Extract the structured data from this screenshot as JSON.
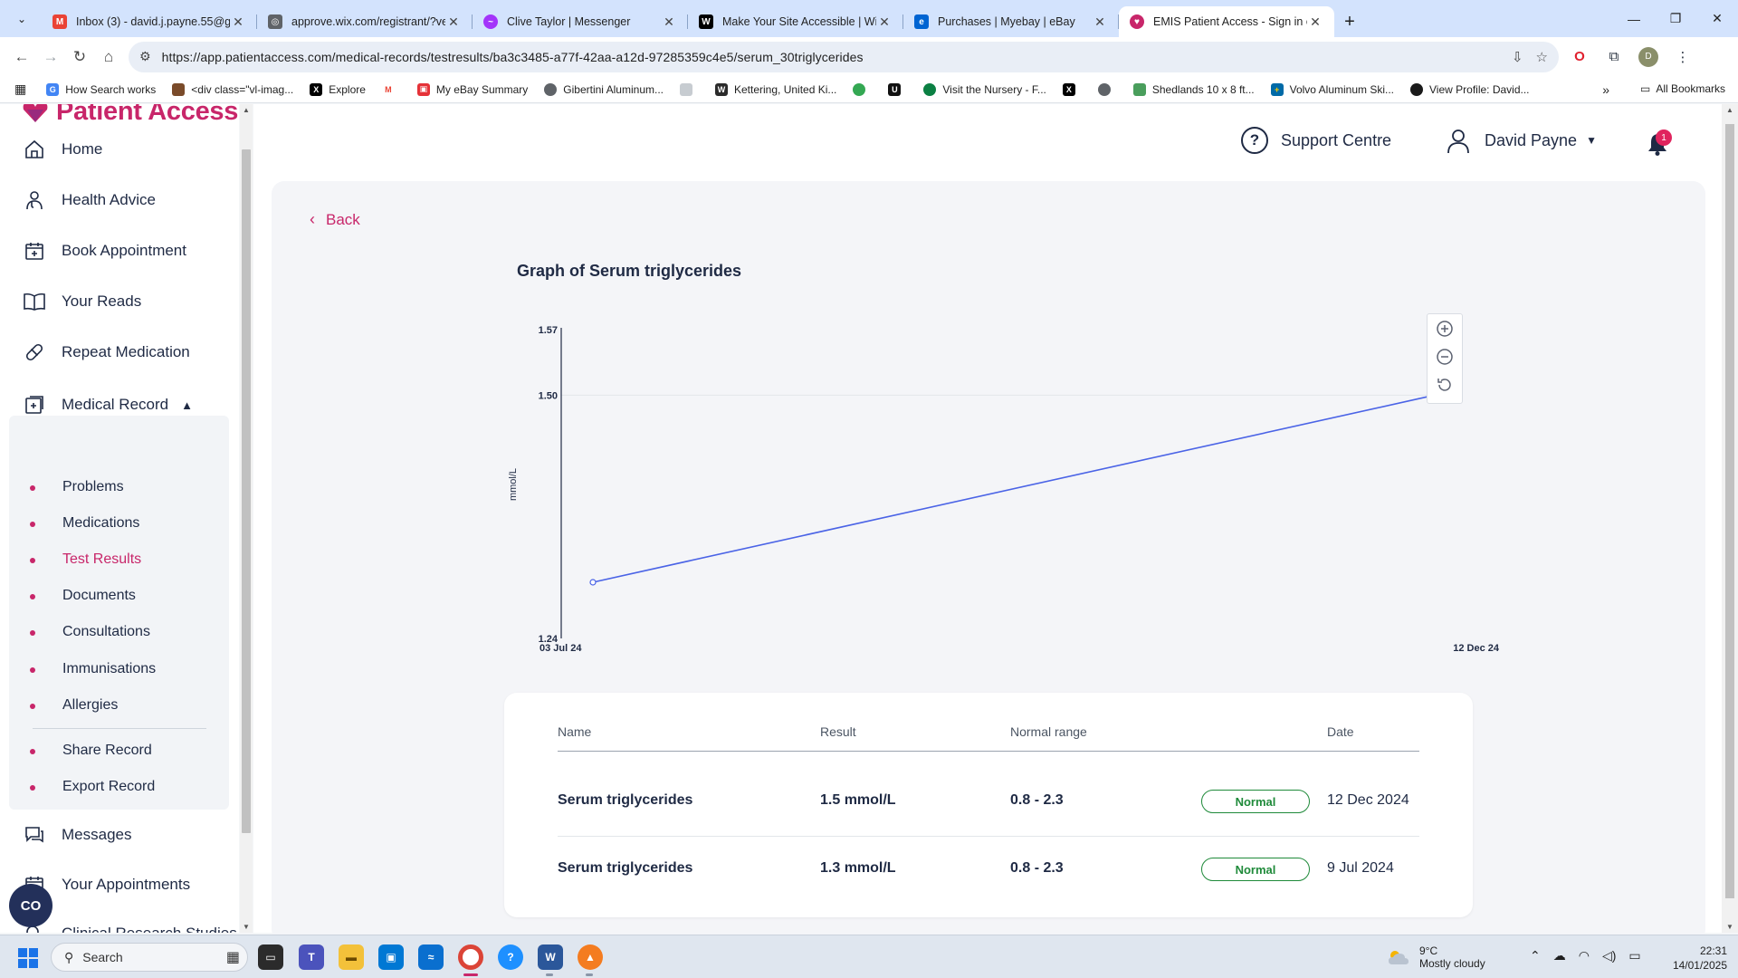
{
  "browser": {
    "tabs": [
      {
        "title": "Inbox (3) - david.j.payne.55@gr",
        "favicon": "gmail-icon",
        "color": "#ea4335"
      },
      {
        "title": "approve.wix.com/registrant/?ve",
        "favicon": "globe-icon",
        "color": "#5f6368"
      },
      {
        "title": "Clive Taylor | Messenger",
        "favicon": "messenger-icon",
        "color": "#a334fa"
      },
      {
        "title": "Make Your Site Accessible | Wix",
        "favicon": "wix-icon",
        "color": "#000000"
      },
      {
        "title": "Purchases | Myebay | eBay",
        "favicon": "ebay-icon",
        "color": "#0064d2"
      },
      {
        "title": "EMIS Patient Access - Sign in o",
        "favicon": "patient-access-icon",
        "color": "#c8266a"
      }
    ],
    "url": "https://app.patientaccess.com/medical-records/testresults/ba3c3485-a77f-42aa-a12d-97285359c4e5/serum_30triglycerides",
    "bookmarks": [
      {
        "label": "How Search works",
        "icon": "google-icon",
        "color": "#4285f4"
      },
      {
        "label": "<div class=\"vl-imag...",
        "icon": "bookmark-icon",
        "color": "#7a4b2a"
      },
      {
        "label": "Explore",
        "icon": "x-icon",
        "color": "#000000"
      },
      {
        "label": "",
        "icon": "gmail-icon",
        "color": "#ea4335"
      },
      {
        "label": "My eBay Summary",
        "icon": "ebay-icon",
        "color": "#e53238"
      },
      {
        "label": "Gibertini Aluminum...",
        "icon": "globe-icon",
        "color": "#5f6368"
      },
      {
        "label": "",
        "icon": "bookmark-icon",
        "color": "#9aa0a6"
      },
      {
        "label": "Kettering, United Ki...",
        "icon": "weather-icon",
        "color": "#2b2b2b"
      },
      {
        "label": "",
        "icon": "bookmark-icon",
        "color": "#34a853"
      },
      {
        "label": "",
        "icon": "bookmark-icon",
        "color": "#111111"
      },
      {
        "label": "Visit the Nursery - F...",
        "icon": "bookmark-icon",
        "color": "#0b8043"
      },
      {
        "label": "",
        "icon": "x-icon",
        "color": "#000000"
      },
      {
        "label": "",
        "icon": "globe-icon",
        "color": "#5f6368"
      },
      {
        "label": "Shedlands 10 x 8 ft...",
        "icon": "bookmark-icon",
        "color": "#4a9e5c"
      },
      {
        "label": "Volvo Aluminum Ski...",
        "icon": "flag-icon",
        "color": "#006aa7"
      },
      {
        "label": "View Profile: David...",
        "icon": "bookmark-icon",
        "color": "#1a1a1a"
      }
    ],
    "all_bookmarks": "All Bookmarks"
  },
  "app": {
    "logo": "Patient Access",
    "support": "Support Centre",
    "user": "David Payne",
    "notifications": "1",
    "chat_label": "CO"
  },
  "sidebar": {
    "items": [
      {
        "label": "Home",
        "icon": "home-icon"
      },
      {
        "label": "Health Advice",
        "icon": "doctor-icon"
      },
      {
        "label": "Book Appointment",
        "icon": "calendar-plus-icon"
      },
      {
        "label": "Your Reads",
        "icon": "book-icon"
      },
      {
        "label": "Repeat Medication",
        "icon": "pill-icon"
      },
      {
        "label": "Medical Record",
        "icon": "medical-record-icon"
      }
    ],
    "sub_items": [
      "Problems",
      "Medications",
      "Test Results",
      "Documents",
      "Consultations",
      "Immunisations",
      "Allergies",
      "Share Record",
      "Export Record"
    ],
    "after_items": [
      {
        "label": "Messages",
        "icon": "messages-icon"
      },
      {
        "label": "Your Appointments",
        "icon": "calendar-icon"
      },
      {
        "label": "Clinical Research Studies",
        "icon": "research-icon"
      }
    ]
  },
  "page": {
    "back": "Back",
    "graph_title": "Graph of Serum triglycerides"
  },
  "chart_data": {
    "type": "line",
    "x": [
      "03 Jul 24",
      "12 Dec 24"
    ],
    "series": [
      {
        "values": [
          1.3,
          1.5
        ]
      }
    ],
    "ylabel": "mmol/L",
    "yticks": [
      "1.57",
      "1.50",
      "1.24"
    ],
    "xticks": [
      "03 Jul 24",
      "12 Dec 24"
    ],
    "ylim": [
      1.24,
      1.57
    ],
    "color": "#4a63e6"
  },
  "table": {
    "headers": [
      "Name",
      "Result",
      "Normal range",
      "Date"
    ],
    "rows": [
      {
        "name": "Serum triglycerides",
        "result": "1.5 mmol/L",
        "range": "0.8 - 2.3",
        "status": "Normal",
        "date": "12 Dec 2024"
      },
      {
        "name": "Serum triglycerides",
        "result": "1.3 mmol/L",
        "range": "0.8 - 2.3",
        "status": "Normal",
        "date": "9 Jul 2024"
      }
    ]
  },
  "taskbar": {
    "search": "Search",
    "weather_temp": "9°C",
    "weather_desc": "Mostly cloudy",
    "time": "22:31",
    "date": "14/01/2025"
  }
}
